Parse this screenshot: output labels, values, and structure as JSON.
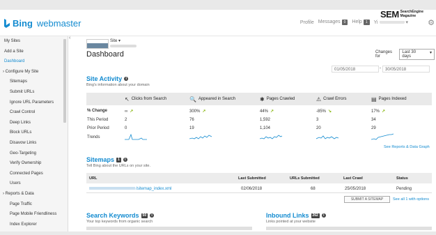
{
  "app": {
    "brand_b": "Bing",
    "brand_rest": "webmaster"
  },
  "watermark": {
    "big": "SEM",
    "small_line1": "SearchEngine",
    "small_line2": "Magazine"
  },
  "topnav": {
    "profile": "Profile",
    "messages": "Messages",
    "messages_count": "0",
    "help": "Help",
    "help_count": "1",
    "user_initials": "Yi"
  },
  "sidebar": {
    "items": [
      {
        "label": "My Sites",
        "level": "top"
      },
      {
        "label": "Add a Site",
        "level": "top"
      },
      {
        "label": "Dashboard",
        "level": "top",
        "active": true
      },
      {
        "label": "Configure My Site",
        "level": "group"
      },
      {
        "label": "Sitemaps",
        "level": "sub"
      },
      {
        "label": "Submit URLs",
        "level": "sub"
      },
      {
        "label": "Ignore URL Parameters",
        "level": "sub"
      },
      {
        "label": "Crawl Control",
        "level": "sub"
      },
      {
        "label": "Deep Links",
        "level": "sub"
      },
      {
        "label": "Block URLs",
        "level": "sub"
      },
      {
        "label": "Disavow Links",
        "level": "sub"
      },
      {
        "label": "Geo-Targeting",
        "level": "sub"
      },
      {
        "label": "Verify Ownership",
        "level": "sub"
      },
      {
        "label": "Connected Pages",
        "level": "sub"
      },
      {
        "label": "Users",
        "level": "sub"
      },
      {
        "label": "Reports & Data",
        "level": "group"
      },
      {
        "label": "Page Traffic",
        "level": "sub"
      },
      {
        "label": "Page Mobile Friendliness",
        "level": "sub"
      },
      {
        "label": "Index Explorer",
        "level": "sub"
      }
    ]
  },
  "site": {
    "label": "Site ▾"
  },
  "page": {
    "title": "Dashboard"
  },
  "changes": {
    "label": "Changes for",
    "selected": "Last 30 days",
    "date_from": "01/05/2018",
    "date_to": "30/05/2018",
    "dash": "-"
  },
  "activity": {
    "title": "Site Activity",
    "subtitle": "Bing's information about your domain",
    "columns": [
      {
        "label": "Clicks from Search",
        "icon": "cursor-icon",
        "glyph": "↖"
      },
      {
        "label": "Appeared in Search",
        "icon": "search-icon",
        "glyph": "🔍"
      },
      {
        "label": "Pages Crawled",
        "icon": "spider-icon",
        "glyph": "✱"
      },
      {
        "label": "Crawl Errors",
        "icon": "error-icon",
        "glyph": "⚠"
      },
      {
        "label": "Pages Indexed",
        "icon": "document-icon",
        "glyph": "▤"
      }
    ],
    "rows": [
      {
        "label": "% Change",
        "values": [
          "∞",
          "300%",
          "44%",
          "-85%",
          "17%"
        ],
        "trend": [
          "up",
          "up",
          "up",
          "down",
          "up"
        ]
      },
      {
        "label": "This Period",
        "values": [
          "2",
          "76",
          "1,592",
          "3",
          "34"
        ]
      },
      {
        "label": "Prior Period",
        "values": [
          "0",
          "19",
          "1,104",
          "20",
          "29"
        ]
      },
      {
        "label": "Trends",
        "values": [
          "",
          "",
          "",
          "",
          ""
        ]
      }
    ],
    "link": "See Reports & Data Graph"
  },
  "sitemaps": {
    "title": "Sitemaps",
    "count": "1",
    "subtitle": "Tell Bing about the URLs on your site.",
    "headers": [
      "URL",
      "Last Submitted",
      "URLs Submitted",
      "Last Crawl",
      "Status"
    ],
    "rows": [
      {
        "url": "/sitemap_index.xml",
        "last_submitted": "02/06/2018",
        "urls_submitted": "68",
        "last_crawl": "25/05/2018",
        "status": "Pending"
      }
    ],
    "submit_button": "SUBMIT A SITEMAP",
    "see_all": "See all 1 with options"
  },
  "keywords": {
    "title": "Search Keywords",
    "count": "50",
    "subtitle": "Your top keywords from organic search"
  },
  "inbound": {
    "title": "Inbound Links",
    "count": "262",
    "subtitle": "Links pointed at your website"
  },
  "colors": {
    "accent": "#138bd0",
    "trend_up": "#8ab814"
  }
}
